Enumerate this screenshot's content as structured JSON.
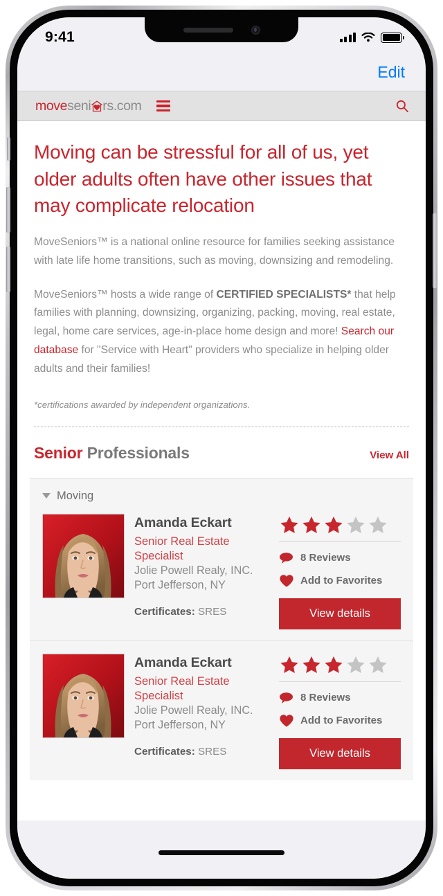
{
  "status_bar": {
    "time": "9:41",
    "signal_icon": "cellular-signal-icon",
    "wifi_icon": "wifi-icon",
    "battery_icon": "battery-icon"
  },
  "ios_navbar": {
    "edit_label": "Edit"
  },
  "site_header": {
    "logo": {
      "part_red": "move",
      "part_gray_1": "seni",
      "heart_house_icon": "heart-house-icon",
      "part_gray_2": "rs.com"
    },
    "menu_icon": "hamburger-menu-icon",
    "search_icon": "search-icon"
  },
  "hero": {
    "headline": "Moving can be stressful for all of us, yet older adults often have other issues that may complicate relocation",
    "paragraph_1": "MoveSeniors™ is a national online resource for families seeking assistance with late life home transitions, such as moving, downsizing and remodeling.",
    "paragraph_2": {
      "before_bold": "MoveSeniors™ hosts a wide range of ",
      "bold": "CERTIFIED SPECIALISTS*",
      "after_bold": " that help families with planning, downsizing, organizing, packing, moving, real estate, legal, home care services, age-in-place home design and more! ",
      "link": "Search our database",
      "after_link": " for \"Service with Heart\" providers who specialize in helping older adults and their families!"
    },
    "footnote": "*certifications awarded by independent organizations."
  },
  "section": {
    "title_red": "Senior",
    "title_gray": " Professionals",
    "view_all": "View All"
  },
  "group": {
    "label": "Moving",
    "caret_icon": "caret-down-icon"
  },
  "professionals": [
    {
      "name": "Amanda Eckart",
      "role": "Senior Real Estate Specialist",
      "company": "Jolie Powell Realy, INC.",
      "location": "Port Jefferson, NY",
      "certificates_label": "Certificates:",
      "certificates_value": "SRES",
      "rating": 3,
      "rating_max": 5,
      "reviews_label": "8 Reviews",
      "reviews_icon": "speech-bubble-icon",
      "favorites_label": "Add to Favorites",
      "favorites_icon": "heart-icon",
      "view_details_label": "View details",
      "avatar_icon": "portrait-photo"
    },
    {
      "name": "Amanda Eckart",
      "role": "Senior Real Estate Specialist",
      "company": "Jolie Powell Realy, INC.",
      "location": "Port Jefferson, NY",
      "certificates_label": "Certificates:",
      "certificates_value": "SRES",
      "rating": 3,
      "rating_max": 5,
      "reviews_label": "8 Reviews",
      "reviews_icon": "speech-bubble-icon",
      "favorites_label": "Add to Favorites",
      "favorites_icon": "heart-icon",
      "view_details_label": "View details",
      "avatar_icon": "portrait-photo"
    }
  ],
  "home_indicator": "home-indicator",
  "colors": {
    "brand_red": "#c9252d",
    "button_red": "#c1272d",
    "link_blue": "#007aff",
    "body_gray": "#8c8c8c",
    "star_active": "#c8262d",
    "star_inactive": "#c4c4c4"
  }
}
